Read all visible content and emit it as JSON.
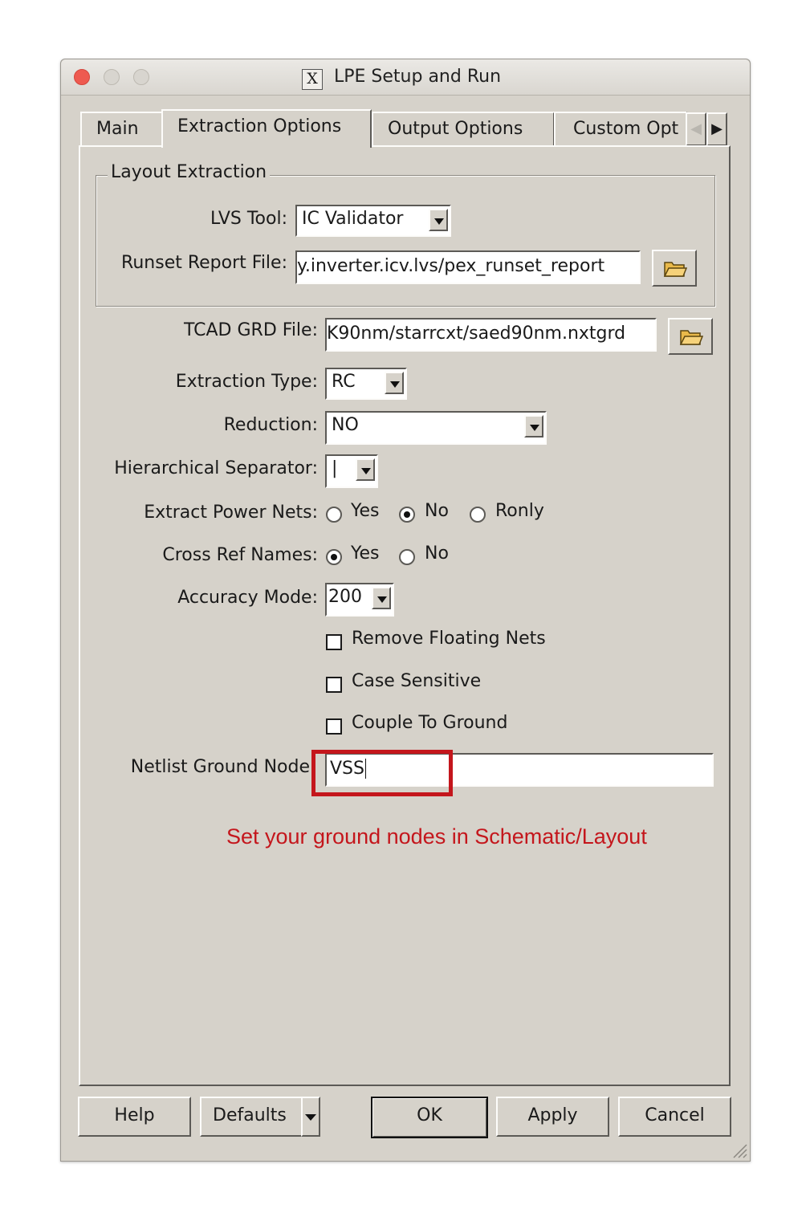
{
  "window": {
    "title": "LPE Setup and Run",
    "x_logo": "X"
  },
  "tabs": [
    {
      "label": "Main"
    },
    {
      "label": "Extraction Options"
    },
    {
      "label": "Output Options"
    },
    {
      "label": "Custom Opt"
    }
  ],
  "layout_extraction": {
    "group_title": "Layout Extraction",
    "lvs_tool_label": "LVS Tool:",
    "lvs_tool_value": "IC Validator",
    "runset_label": "Runset Report File:",
    "runset_value": "y.inverter.icv.lvs/pex_runset_report"
  },
  "form": {
    "tcad_label": "TCAD GRD File:",
    "tcad_value": "K90nm/starrcxt/saed90nm.nxtgrd",
    "extraction_type_label": "Extraction Type:",
    "extraction_type_value": "RC",
    "reduction_label": "Reduction:",
    "reduction_value": "NO",
    "hier_sep_label": "Hierarchical Separator:",
    "hier_sep_value": "|",
    "power_nets_label": "Extract Power Nets:",
    "power_nets_options": [
      "Yes",
      "No",
      "Ronly"
    ],
    "power_nets_selected": "No",
    "cross_ref_label": "Cross Ref Names:",
    "cross_ref_options": [
      "Yes",
      "No"
    ],
    "cross_ref_selected": "Yes",
    "accuracy_label": "Accuracy Mode:",
    "accuracy_value": "200",
    "remove_floating_label": "Remove Floating Nets",
    "case_sensitive_label": "Case Sensitive",
    "couple_ground_label": "Couple To Ground",
    "netlist_ground_label": "Netlist Ground Node",
    "netlist_ground_value": "VSS"
  },
  "annotation": {
    "note": "Set your ground nodes in Schematic/Layout",
    "color": "#c4161c"
  },
  "buttons": {
    "help": "Help",
    "defaults": "Defaults",
    "ok": "OK",
    "apply": "Apply",
    "cancel": "Cancel"
  }
}
